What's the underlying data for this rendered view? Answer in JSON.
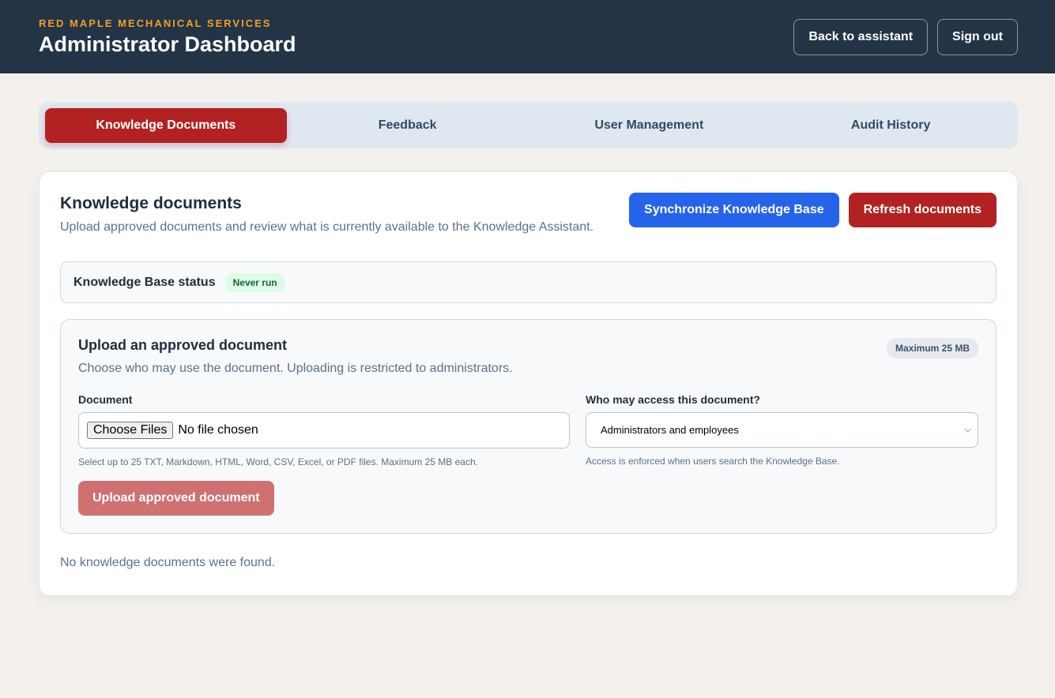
{
  "header": {
    "kicker": "RED MAPLE MECHANICAL SERVICES",
    "title": "Administrator Dashboard",
    "back_label": "Back to assistant",
    "signout_label": "Sign out"
  },
  "tabs": [
    {
      "label": "Knowledge Documents",
      "active": true
    },
    {
      "label": "Feedback",
      "active": false
    },
    {
      "label": "User Management",
      "active": false
    },
    {
      "label": "Audit History",
      "active": false
    }
  ],
  "panel": {
    "title": "Knowledge documents",
    "subtitle": "Upload approved documents and review what is currently available to the Knowledge Assistant.",
    "sync_label": "Synchronize Knowledge Base",
    "refresh_label": "Refresh documents",
    "status_label": "Knowledge Base status",
    "status_value": "Never run",
    "empty_text": "No knowledge documents were found."
  },
  "upload": {
    "title": "Upload an approved document",
    "subtitle": "Choose who may use the document. Uploading is restricted to administrators.",
    "max_badge": "Maximum 25 MB",
    "doc_label": "Document",
    "choose_label": "Choose Files",
    "no_file": "No file chosen",
    "doc_hint": "Select up to 25 TXT, Markdown, HTML, Word, CSV, Excel, or PDF files. Maximum 25 MB each.",
    "access_label": "Who may access this document?",
    "access_value": "Administrators and employees",
    "access_hint": "Access is enforced when users search the Knowledge Base.",
    "submit_label": "Upload approved document"
  },
  "colors": {
    "header_bg": "#243447",
    "accent_red": "#b22222",
    "accent_blue": "#2563eb",
    "kicker_orange": "#f0a020"
  }
}
